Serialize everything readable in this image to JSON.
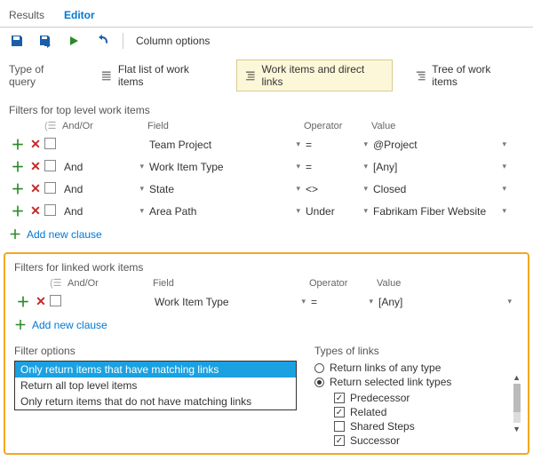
{
  "tabs": {
    "results": "Results",
    "editor": "Editor"
  },
  "toolbar": {
    "column_options": "Column options"
  },
  "query_type": {
    "label": "Type of query",
    "flat": "Flat list of work items",
    "direct": "Work items and direct links",
    "tree": "Tree of work items"
  },
  "top_filters": {
    "label": "Filters for top level work items",
    "headers": {
      "andor": "And/Or",
      "field": "Field",
      "operator": "Operator",
      "value": "Value"
    },
    "rows": [
      {
        "andor": "",
        "field": "Team Project",
        "operator": "=",
        "value": "@Project"
      },
      {
        "andor": "And",
        "field": "Work Item Type",
        "operator": "=",
        "value": "[Any]"
      },
      {
        "andor": "And",
        "field": "State",
        "operator": "<>",
        "value": "Closed"
      },
      {
        "andor": "And",
        "field": "Area Path",
        "operator": "Under",
        "value": "Fabrikam Fiber Website"
      }
    ],
    "add": "Add new clause"
  },
  "linked_filters": {
    "label": "Filters for linked work items",
    "headers": {
      "andor": "And/Or",
      "field": "Field",
      "operator": "Operator",
      "value": "Value"
    },
    "rows": [
      {
        "andor": "",
        "field": "Work Item Type",
        "operator": "=",
        "value": "[Any]"
      }
    ],
    "add": "Add new clause"
  },
  "filter_options": {
    "label": "Filter options",
    "items": [
      "Only return items that have matching links",
      "Return all top level items",
      "Only return items that do not have matching links"
    ],
    "selected_index": 0
  },
  "types_of_links": {
    "label": "Types of links",
    "any": "Return links of any type",
    "selected": "Return selected link types",
    "mode": "selected",
    "types": [
      {
        "label": "Predecessor",
        "checked": true
      },
      {
        "label": "Related",
        "checked": true
      },
      {
        "label": "Shared Steps",
        "checked": false
      },
      {
        "label": "Successor",
        "checked": true
      }
    ]
  }
}
